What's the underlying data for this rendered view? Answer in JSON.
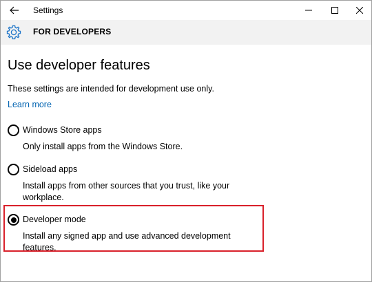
{
  "window": {
    "title": "Settings",
    "controls": [
      "minimize",
      "maximize",
      "close"
    ]
  },
  "header": {
    "title": "FOR DEVELOPERS",
    "icon": "gear-icon"
  },
  "main": {
    "page_title": "Use developer features",
    "intro": "These settings are intended for development use only.",
    "learn_more": "Learn more"
  },
  "options": [
    {
      "label": "Windows Store apps",
      "description": "Only install apps from the Windows Store.",
      "selected": false
    },
    {
      "label": "Sideload apps",
      "description": "Install apps from other sources that you trust, like your workplace.",
      "selected": false
    },
    {
      "label": "Developer mode",
      "description": "Install any signed app and use advanced development features.",
      "selected": true
    }
  ],
  "colors": {
    "accent_link": "#0063b1",
    "header_bg": "#f2f2f2",
    "highlight_border": "#d9202a"
  }
}
